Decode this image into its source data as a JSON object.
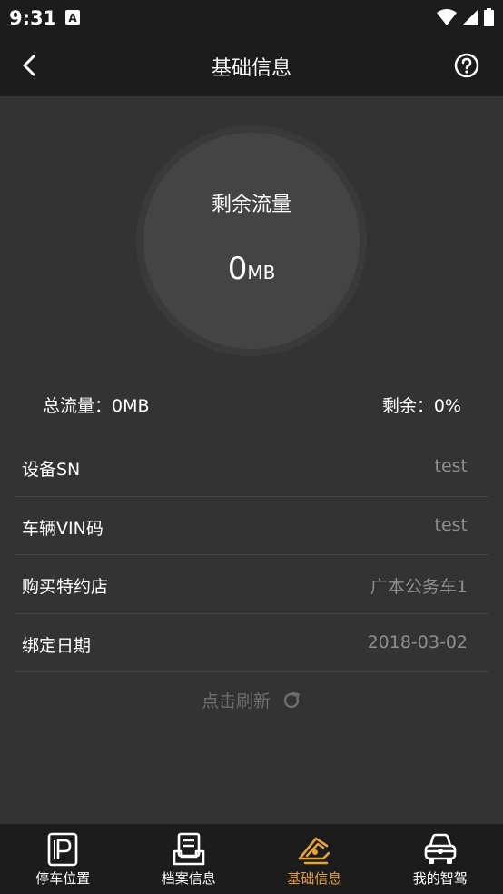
{
  "status_bar": {
    "time": "9:31"
  },
  "app_bar": {
    "title": "基础信息"
  },
  "gauge": {
    "label": "剩余流量",
    "value": "0",
    "unit": "MB"
  },
  "summary": {
    "total": "总流量：0MB",
    "remaining": "剩余：0%"
  },
  "info": {
    "rows": [
      {
        "label": "设备SN",
        "value": "test"
      },
      {
        "label": "车辆VIN码",
        "value": "test"
      },
      {
        "label": "购买特约店",
        "value": "广本公务车1"
      },
      {
        "label": "绑定日期",
        "value": "2018-03-02"
      }
    ]
  },
  "refresh": {
    "label": "点击刷新"
  },
  "bottom_nav": {
    "items": [
      {
        "label": "停车位置",
        "icon": "parking-icon"
      },
      {
        "label": "档案信息",
        "icon": "archive-icon"
      },
      {
        "label": "基础信息",
        "icon": "basic-info-icon",
        "active": true
      },
      {
        "label": "我的智驾",
        "icon": "car-icon"
      }
    ]
  },
  "colors": {
    "accent": "#e6a23c",
    "background": "#333333",
    "bar": "#1c1c1c"
  }
}
